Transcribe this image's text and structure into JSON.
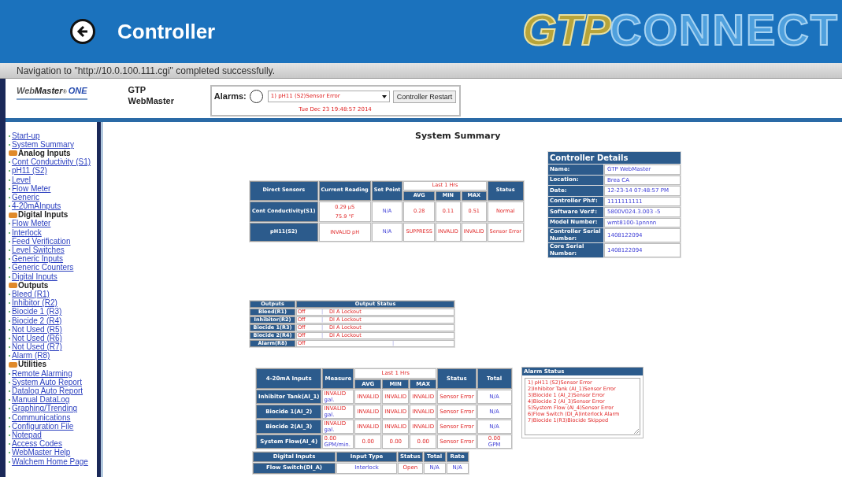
{
  "header": {
    "title": "Controller",
    "logo": [
      "GTP",
      "CONNECT"
    ]
  },
  "navigation_message": "Navigation to \"http://10.0.100.111.cgi\" completed successfully.",
  "webmaster": {
    "logo": [
      "Web",
      "Master",
      "®",
      "ONE"
    ],
    "unit_name": "GTP WebMaster",
    "alarms_label": "Alarms:",
    "alarm_select": "1) pH11 (S2)Sensor Error",
    "restart_button": "Controller Restart",
    "timestamp": "Tue Dec 23 19:48:57 2014"
  },
  "sidebar": {
    "items": [
      {
        "kind": "link",
        "label": "Start-up"
      },
      {
        "kind": "link",
        "label": "System Summary"
      },
      {
        "kind": "heading",
        "label": "Analog Inputs"
      },
      {
        "kind": "link",
        "label": "Cont Conductivity (S1)"
      },
      {
        "kind": "link",
        "label": "pH11 (S2)"
      },
      {
        "kind": "link",
        "label": "Level"
      },
      {
        "kind": "link",
        "label": "Flow Meter"
      },
      {
        "kind": "link",
        "label": "Generic"
      },
      {
        "kind": "link",
        "label": "4-20mAInputs"
      },
      {
        "kind": "heading",
        "label": "Digital Inputs"
      },
      {
        "kind": "link",
        "label": "Flow Meter"
      },
      {
        "kind": "link",
        "label": "Interlock"
      },
      {
        "kind": "link",
        "label": "Feed Verification"
      },
      {
        "kind": "link",
        "label": "Level Switches"
      },
      {
        "kind": "link",
        "label": "Generic Inputs"
      },
      {
        "kind": "link",
        "label": "Generic Counters"
      },
      {
        "kind": "link",
        "label": "Digital Inputs"
      },
      {
        "kind": "heading",
        "label": "Outputs"
      },
      {
        "kind": "link",
        "label": "Bleed (R1)"
      },
      {
        "kind": "link",
        "label": "Inhibitor (R2)"
      },
      {
        "kind": "link",
        "label": "Biocide 1 (R3)"
      },
      {
        "kind": "link",
        "label": "Biocide 2 (R4)"
      },
      {
        "kind": "link",
        "label": "Not Used (R5)"
      },
      {
        "kind": "link",
        "label": "Not Used (R6)"
      },
      {
        "kind": "link",
        "label": "Not Used (R7)"
      },
      {
        "kind": "link",
        "label": "Alarm (R8)"
      },
      {
        "kind": "heading",
        "label": "Utilities"
      },
      {
        "kind": "link",
        "label": "Remote Alarming"
      },
      {
        "kind": "link",
        "label": "System Auto Report"
      },
      {
        "kind": "link",
        "label": "Datalog Auto Report"
      },
      {
        "kind": "link",
        "label": "Manual DataLog"
      },
      {
        "kind": "link",
        "label": "Graphing/Trending"
      },
      {
        "kind": "link",
        "label": "Communications"
      },
      {
        "kind": "link",
        "label": "Configuration File"
      },
      {
        "kind": "link",
        "label": "Notepad"
      },
      {
        "kind": "link",
        "label": "Access Codes"
      },
      {
        "kind": "link",
        "label": "WebMaster Help"
      },
      {
        "kind": "link",
        "label": "Walchem Home Page"
      }
    ]
  },
  "page_title": "System Summary",
  "direct_sensors": {
    "columns": [
      "Direct Sensors",
      "Current Reading",
      "Set Point",
      "Last 1 Hrs",
      "Status"
    ],
    "subcolumns": [
      "AVG",
      "MIN",
      "MAX"
    ],
    "rows": [
      {
        "name": "Cont Conductivity(S1)",
        "reading": [
          "0.29 µS",
          "75.9 °F"
        ],
        "set_point": "N/A",
        "avg": "0.28",
        "min": "0.11",
        "max": "0.51",
        "status": "Normal"
      },
      {
        "name": "pH11(S2)",
        "reading": [
          "INVALID pH"
        ],
        "set_point": "N/A",
        "avg": "SUPPRESS",
        "min": "INVALID",
        "max": "INVALID",
        "status": "Sensor Error"
      }
    ]
  },
  "controller_details": {
    "title": "Controller Details",
    "rows": [
      {
        "label": "Name:",
        "value": "GTP WebMaster"
      },
      {
        "label": "Location:",
        "value": "Brea CA"
      },
      {
        "label": "Date:",
        "value": "12-23-14 07:48:57 PM"
      },
      {
        "label": "Controller Ph#:",
        "value": "1111111111"
      },
      {
        "label": "Software Ver#:",
        "value": "5800V024.3.003 -5"
      },
      {
        "label": "Model Number:",
        "value": "wmt8100-1pnnnn"
      },
      {
        "label": "Controller Serial Number:",
        "value": "1408122094"
      },
      {
        "label": "Core Serial Number:",
        "value": "1408122094"
      }
    ]
  },
  "outputs": {
    "columns": [
      "Outputs",
      "Output Status"
    ],
    "rows": [
      {
        "name": "Bleed(R1)",
        "state": "Off",
        "separator": "|",
        "status": "DI A Lockout"
      },
      {
        "name": "Inhibitor(R2)",
        "state": "Off",
        "separator": "|",
        "status": "DI A Lockout"
      },
      {
        "name": "Biocide 1(R3)",
        "state": "Off",
        "separator": "|",
        "status": "DI A Lockout"
      },
      {
        "name": "Biocide 2(R4)",
        "state": "Off",
        "separator": "|",
        "status": "DI A Lockout"
      },
      {
        "name": "Alarm(R8)",
        "state": "Off",
        "separator": "|"
      }
    ]
  },
  "analog_inputs": {
    "columns": [
      "4-20mA Inputs",
      "Measure",
      "Last 1 Hrs",
      "Status",
      "Total"
    ],
    "subcolumns": [
      "AVG",
      "MIN",
      "MAX"
    ],
    "rows": [
      {
        "name": "Inhibitor Tank(AI_1)",
        "measure": "INVALID",
        "unit": "gal.",
        "avg": "INVALID",
        "min": "INVALID",
        "max": "INVALID",
        "status": "Sensor Error",
        "total": "N/A"
      },
      {
        "name": "Biocide 1(AI_2)",
        "measure": "INVALID",
        "unit": "gal.",
        "avg": "INVALID",
        "min": "INVALID",
        "max": "INVALID",
        "status": "Sensor Error",
        "total": "N/A"
      },
      {
        "name": "Biocide 2(AI_3)",
        "measure": "INVALID",
        "unit": "gal.",
        "avg": "INVALID",
        "min": "INVALID",
        "max": "INVALID",
        "status": "Sensor Error",
        "total": "N/A"
      },
      {
        "name": "System Flow(AI_4)",
        "measure": "0.00",
        "unit": "GPM/min.",
        "avg": "0.00",
        "min": "0.00",
        "max": "0.00",
        "status": "Sensor Error",
        "total": "0.00",
        "total_unit": "GPM"
      }
    ]
  },
  "alarm_status": {
    "title": "Alarm Status",
    "lines": [
      "1) pH11 (S2)Sensor Error",
      "2)Inhibitor Tank (AI_1)Sensor Error",
      "3)Biocide 1 (AI_2)Sensor Error",
      "4)Biocide 2 (AI_3)Sensor Error",
      "5)System Flow (AI_4)Sensor Error",
      "6)Flow Switch (DI_A)Interlock Alarm",
      "7)Biocide 1(R3)Biocide Skipped"
    ]
  },
  "digital_inputs": {
    "columns": [
      "Digital Inputs",
      "Input Type",
      "Status",
      "Total",
      "Rate"
    ],
    "rows": [
      {
        "name": "Flow Switch(DI_A)",
        "input_type": "Interlock",
        "status": "Open",
        "total": "N/A",
        "rate": "N/A"
      }
    ]
  }
}
